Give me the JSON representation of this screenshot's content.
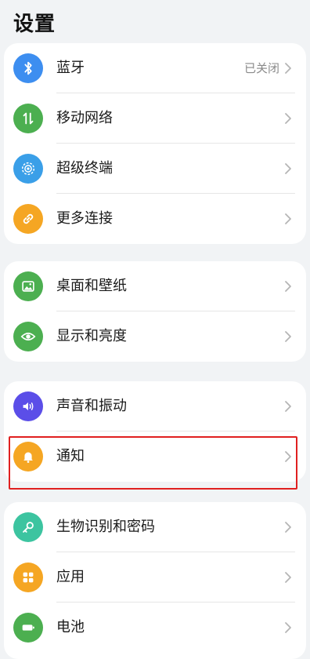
{
  "page": {
    "title": "设置"
  },
  "groups": [
    {
      "items": [
        {
          "label": "蓝牙",
          "value": "已关闭",
          "icon": "bluetooth-icon",
          "color": "#3d8ef0"
        },
        {
          "label": "移动网络",
          "value": "",
          "icon": "mobile-network-icon",
          "color": "#4caf50"
        },
        {
          "label": "超级终端",
          "value": "",
          "icon": "super-device-icon",
          "color": "#3a9fe8"
        },
        {
          "label": "更多连接",
          "value": "",
          "icon": "link-icon",
          "color": "#f5a623"
        }
      ]
    },
    {
      "items": [
        {
          "label": "桌面和壁纸",
          "value": "",
          "icon": "wallpaper-icon",
          "color": "#4caf50"
        },
        {
          "label": "显示和亮度",
          "value": "",
          "icon": "eye-icon",
          "color": "#4caf50"
        }
      ]
    },
    {
      "items": [
        {
          "label": "声音和振动",
          "value": "",
          "icon": "volume-icon",
          "color": "#5b4ee8"
        },
        {
          "label": "通知",
          "value": "",
          "icon": "bell-icon",
          "color": "#f5a623"
        }
      ]
    },
    {
      "items": [
        {
          "label": "生物识别和密码",
          "value": "",
          "icon": "key-icon",
          "color": "#3cc4a0"
        },
        {
          "label": "应用",
          "value": "",
          "icon": "apps-icon",
          "color": "#f5a623"
        },
        {
          "label": "电池",
          "value": "",
          "icon": "battery-icon",
          "color": "#4caf50"
        }
      ]
    }
  ],
  "highlight_color": "#e02020"
}
